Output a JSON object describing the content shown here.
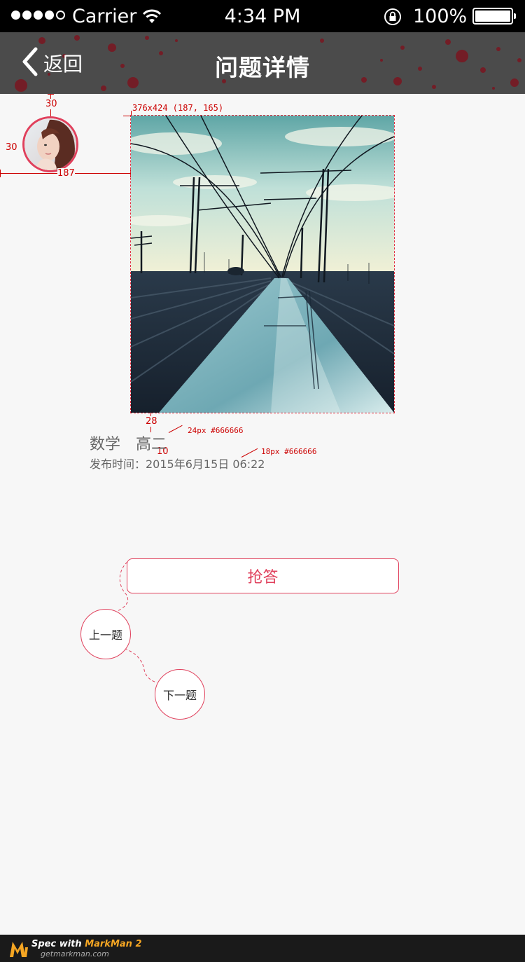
{
  "status_bar": {
    "carrier": "Carrier",
    "time": "4:34 PM",
    "battery_percent": "100%",
    "signal_bars_filled": 4,
    "signal_bars_total": 5,
    "battery_level": 1.0
  },
  "nav": {
    "back_label": "返回",
    "title": "问题详情"
  },
  "question": {
    "subject": "数学",
    "grade": "高二",
    "publish_time": "发布时间：2015年6月15日 06:22"
  },
  "actions": {
    "grab_label": "抢答",
    "prev_label": "上一题",
    "next_label": "下一题"
  },
  "annotations": {
    "avatar_top": "30",
    "avatar_left": "30",
    "photo_left": "187",
    "photo_spec": "376x424 (187, 165)",
    "photo_gap": "28",
    "line_gap": "10",
    "subject_font": "24px #666666",
    "publish_font": "18px #666666"
  },
  "footer": {
    "brand_prefix": "Spec with ",
    "brand_name": "MarkMan 2",
    "site": "getmarkman.com"
  },
  "colors": {
    "accent": "#e0405c",
    "navbar": "#4b4b4b",
    "background": "#f7f7f7",
    "annotation": "#cc0000",
    "text_secondary": "#666666"
  },
  "icons": {
    "back": "chevron-left-icon",
    "wifi": "wifi-icon",
    "lock": "rotation-lock-icon",
    "battery": "battery-icon"
  }
}
